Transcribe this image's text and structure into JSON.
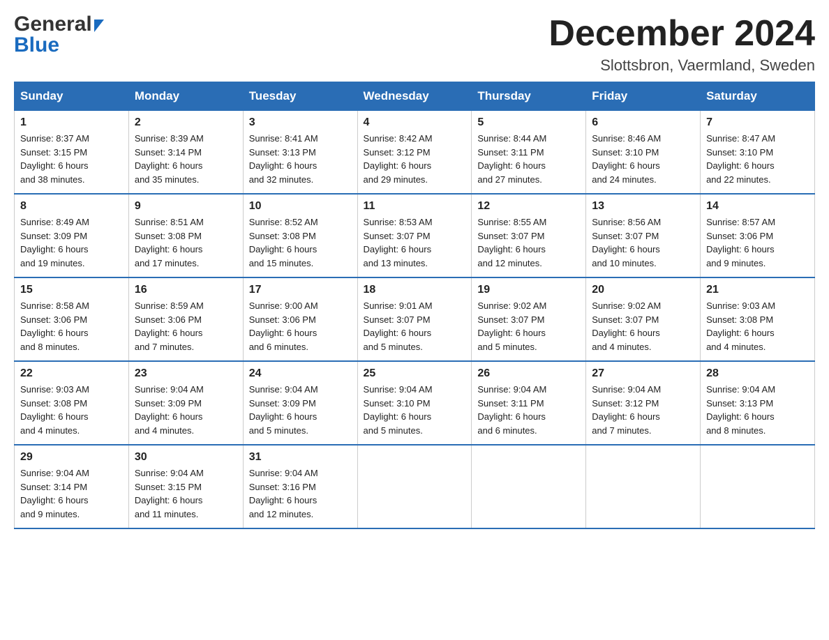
{
  "header": {
    "month_year": "December 2024",
    "location": "Slottsbron, Vaermland, Sweden",
    "logo_general": "General",
    "logo_blue": "Blue"
  },
  "days_of_week": [
    "Sunday",
    "Monday",
    "Tuesday",
    "Wednesday",
    "Thursday",
    "Friday",
    "Saturday"
  ],
  "weeks": [
    [
      {
        "num": "1",
        "sunrise": "8:37 AM",
        "sunset": "3:15 PM",
        "daylight": "6 hours and 38 minutes."
      },
      {
        "num": "2",
        "sunrise": "8:39 AM",
        "sunset": "3:14 PM",
        "daylight": "6 hours and 35 minutes."
      },
      {
        "num": "3",
        "sunrise": "8:41 AM",
        "sunset": "3:13 PM",
        "daylight": "6 hours and 32 minutes."
      },
      {
        "num": "4",
        "sunrise": "8:42 AM",
        "sunset": "3:12 PM",
        "daylight": "6 hours and 29 minutes."
      },
      {
        "num": "5",
        "sunrise": "8:44 AM",
        "sunset": "3:11 PM",
        "daylight": "6 hours and 27 minutes."
      },
      {
        "num": "6",
        "sunrise": "8:46 AM",
        "sunset": "3:10 PM",
        "daylight": "6 hours and 24 minutes."
      },
      {
        "num": "7",
        "sunrise": "8:47 AM",
        "sunset": "3:10 PM",
        "daylight": "6 hours and 22 minutes."
      }
    ],
    [
      {
        "num": "8",
        "sunrise": "8:49 AM",
        "sunset": "3:09 PM",
        "daylight": "6 hours and 19 minutes."
      },
      {
        "num": "9",
        "sunrise": "8:51 AM",
        "sunset": "3:08 PM",
        "daylight": "6 hours and 17 minutes."
      },
      {
        "num": "10",
        "sunrise": "8:52 AM",
        "sunset": "3:08 PM",
        "daylight": "6 hours and 15 minutes."
      },
      {
        "num": "11",
        "sunrise": "8:53 AM",
        "sunset": "3:07 PM",
        "daylight": "6 hours and 13 minutes."
      },
      {
        "num": "12",
        "sunrise": "8:55 AM",
        "sunset": "3:07 PM",
        "daylight": "6 hours and 12 minutes."
      },
      {
        "num": "13",
        "sunrise": "8:56 AM",
        "sunset": "3:07 PM",
        "daylight": "6 hours and 10 minutes."
      },
      {
        "num": "14",
        "sunrise": "8:57 AM",
        "sunset": "3:06 PM",
        "daylight": "6 hours and 9 minutes."
      }
    ],
    [
      {
        "num": "15",
        "sunrise": "8:58 AM",
        "sunset": "3:06 PM",
        "daylight": "6 hours and 8 minutes."
      },
      {
        "num": "16",
        "sunrise": "8:59 AM",
        "sunset": "3:06 PM",
        "daylight": "6 hours and 7 minutes."
      },
      {
        "num": "17",
        "sunrise": "9:00 AM",
        "sunset": "3:06 PM",
        "daylight": "6 hours and 6 minutes."
      },
      {
        "num": "18",
        "sunrise": "9:01 AM",
        "sunset": "3:07 PM",
        "daylight": "6 hours and 5 minutes."
      },
      {
        "num": "19",
        "sunrise": "9:02 AM",
        "sunset": "3:07 PM",
        "daylight": "6 hours and 5 minutes."
      },
      {
        "num": "20",
        "sunrise": "9:02 AM",
        "sunset": "3:07 PM",
        "daylight": "6 hours and 4 minutes."
      },
      {
        "num": "21",
        "sunrise": "9:03 AM",
        "sunset": "3:08 PM",
        "daylight": "6 hours and 4 minutes."
      }
    ],
    [
      {
        "num": "22",
        "sunrise": "9:03 AM",
        "sunset": "3:08 PM",
        "daylight": "6 hours and 4 minutes."
      },
      {
        "num": "23",
        "sunrise": "9:04 AM",
        "sunset": "3:09 PM",
        "daylight": "6 hours and 4 minutes."
      },
      {
        "num": "24",
        "sunrise": "9:04 AM",
        "sunset": "3:09 PM",
        "daylight": "6 hours and 5 minutes."
      },
      {
        "num": "25",
        "sunrise": "9:04 AM",
        "sunset": "3:10 PM",
        "daylight": "6 hours and 5 minutes."
      },
      {
        "num": "26",
        "sunrise": "9:04 AM",
        "sunset": "3:11 PM",
        "daylight": "6 hours and 6 minutes."
      },
      {
        "num": "27",
        "sunrise": "9:04 AM",
        "sunset": "3:12 PM",
        "daylight": "6 hours and 7 minutes."
      },
      {
        "num": "28",
        "sunrise": "9:04 AM",
        "sunset": "3:13 PM",
        "daylight": "6 hours and 8 minutes."
      }
    ],
    [
      {
        "num": "29",
        "sunrise": "9:04 AM",
        "sunset": "3:14 PM",
        "daylight": "6 hours and 9 minutes."
      },
      {
        "num": "30",
        "sunrise": "9:04 AM",
        "sunset": "3:15 PM",
        "daylight": "6 hours and 11 minutes."
      },
      {
        "num": "31",
        "sunrise": "9:04 AM",
        "sunset": "3:16 PM",
        "daylight": "6 hours and 12 minutes."
      },
      null,
      null,
      null,
      null
    ]
  ],
  "labels": {
    "sunrise": "Sunrise:",
    "sunset": "Sunset:",
    "daylight": "Daylight:"
  }
}
